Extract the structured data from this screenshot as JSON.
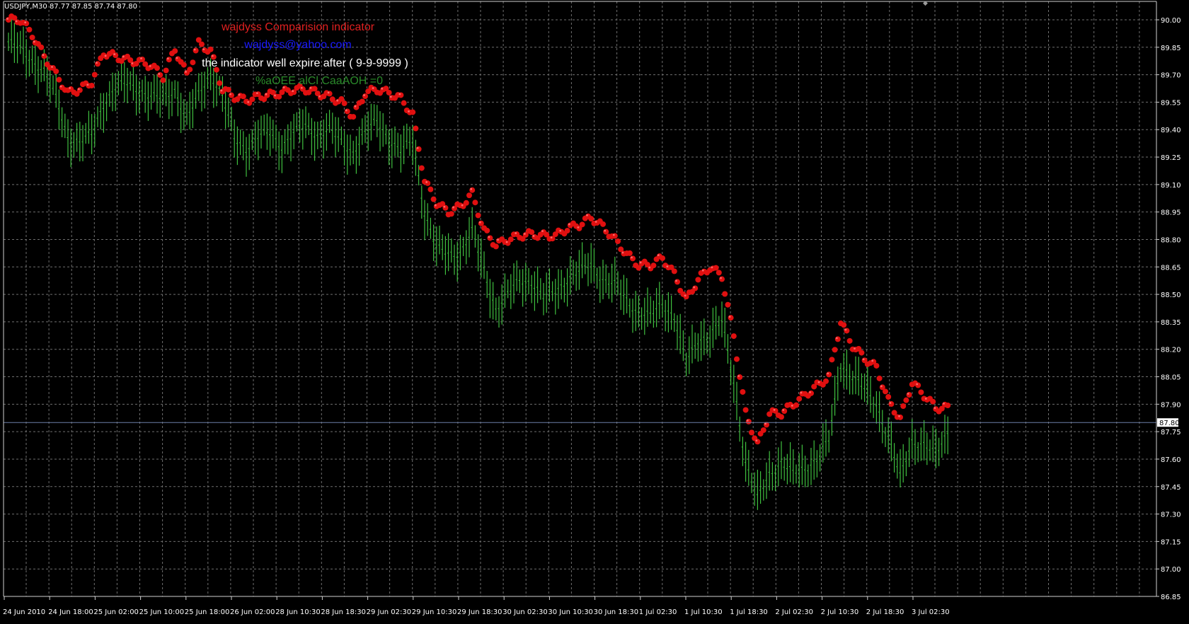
{
  "header": {
    "symbol_info": "USDJPY,M30  87.77 87.85 87.74 87.80",
    "scroll_marker": "◆"
  },
  "indicator": {
    "title": "wajdyss Comparision indicator",
    "email": "wajdyss@yahoo.com",
    "expiry": "the indicator well expire after ( 9-9-9999 )",
    "garbled_line": "%aOEE alCl CaaAOH =0"
  },
  "colors": {
    "background": "#000000",
    "grid": "#6f6f6f",
    "price_bars": "#3fbf3f",
    "indicator_markers": "#e01010",
    "title_text": "#e02020",
    "email_text": "#1a1aff",
    "expiry_text": "#ffffff",
    "garbled_text": "#2a8a2a",
    "current_price_line": "#6c7fa8"
  },
  "chart_data": {
    "type": "bar",
    "title": "",
    "xlabel": "",
    "ylabel": "",
    "ylim": [
      86.85,
      90.0
    ],
    "grid": true,
    "y_ticks": [
      "90.00",
      "89.85",
      "89.70",
      "89.55",
      "89.40",
      "89.25",
      "89.10",
      "88.95",
      "88.80",
      "88.65",
      "88.50",
      "88.35",
      "88.20",
      "88.05",
      "87.90",
      "87.75",
      "87.60",
      "87.45",
      "87.30",
      "87.15",
      "87.00",
      "86.85"
    ],
    "x_ticks": [
      "24 Jun 2010",
      "24 Jun 18:00",
      "25 Jun 02:00",
      "25 Jun 10:00",
      "25 Jun 18:00",
      "26 Jun 02:00",
      "28 Jun 10:30",
      "28 Jun 18:30",
      "29 Jun 02:30",
      "29 Jun 10:30",
      "29 Jun 18:30",
      "30 Jun 02:30",
      "30 Jun 10:30",
      "30 Jun 18:30",
      "1 Jul 02:30",
      "1 Jul 10:30",
      "1 Jul 18:30",
      "2 Jul 02:30",
      "2 Jul 10:30",
      "2 Jul 18:30",
      "3 Jul 02:30"
    ],
    "current_price": 87.8,
    "current_price_label": "87.80",
    "series": [
      {
        "kind": "price-bars",
        "points": [
          [
            0,
            89.88
          ],
          [
            4,
            89.84
          ],
          [
            8,
            89.78
          ],
          [
            12,
            89.72
          ],
          [
            16,
            89.57
          ],
          [
            20,
            89.36
          ],
          [
            24,
            89.33
          ],
          [
            28,
            89.37
          ],
          [
            32,
            89.54
          ],
          [
            36,
            89.63
          ],
          [
            40,
            89.65
          ],
          [
            44,
            89.62
          ],
          [
            48,
            89.58
          ],
          [
            52,
            89.57
          ],
          [
            56,
            89.62
          ],
          [
            60,
            89.45
          ],
          [
            64,
            89.59
          ],
          [
            68,
            89.71
          ],
          [
            72,
            89.58
          ],
          [
            76,
            89.35
          ],
          [
            80,
            89.3
          ],
          [
            84,
            89.36
          ],
          [
            88,
            89.38
          ],
          [
            92,
            89.31
          ],
          [
            96,
            89.38
          ],
          [
            100,
            89.42
          ],
          [
            104,
            89.37
          ],
          [
            108,
            89.4
          ],
          [
            112,
            89.33
          ],
          [
            116,
            89.28
          ],
          [
            120,
            89.38
          ],
          [
            124,
            89.45
          ],
          [
            128,
            89.35
          ],
          [
            132,
            89.28
          ],
          [
            136,
            89.34
          ],
          [
            140,
            88.95
          ],
          [
            144,
            88.75
          ],
          [
            148,
            88.72
          ],
          [
            152,
            88.73
          ],
          [
            156,
            88.84
          ],
          [
            160,
            88.63
          ],
          [
            164,
            88.42
          ],
          [
            168,
            88.5
          ],
          [
            172,
            88.58
          ],
          [
            176,
            88.57
          ],
          [
            180,
            88.48
          ],
          [
            184,
            88.52
          ],
          [
            188,
            88.58
          ],
          [
            192,
            88.62
          ],
          [
            196,
            88.67
          ],
          [
            200,
            88.58
          ],
          [
            204,
            88.55
          ],
          [
            208,
            88.47
          ],
          [
            212,
            88.4
          ],
          [
            216,
            88.38
          ],
          [
            220,
            88.45
          ],
          [
            224,
            88.38
          ],
          [
            228,
            88.12
          ],
          [
            232,
            88.25
          ],
          [
            236,
            88.28
          ],
          [
            240,
            88.35
          ],
          [
            244,
            88.02
          ],
          [
            248,
            87.58
          ],
          [
            252,
            87.38
          ],
          [
            256,
            87.52
          ],
          [
            260,
            87.58
          ],
          [
            264,
            87.52
          ],
          [
            268,
            87.55
          ],
          [
            272,
            87.6
          ],
          [
            276,
            87.7
          ],
          [
            280,
            88.12
          ],
          [
            284,
            88.05
          ],
          [
            288,
            87.98
          ],
          [
            292,
            87.9
          ],
          [
            296,
            87.72
          ],
          [
            300,
            87.5
          ],
          [
            304,
            87.7
          ],
          [
            308,
            87.68
          ],
          [
            312,
            87.62
          ],
          [
            316,
            87.75
          ]
        ]
      },
      {
        "kind": "indicator-markers",
        "points": [
          [
            0,
            90.0
          ],
          [
            4,
            90.0
          ],
          [
            8,
            89.92
          ],
          [
            12,
            89.8
          ],
          [
            16,
            89.7
          ],
          [
            20,
            89.6
          ],
          [
            24,
            89.62
          ],
          [
            28,
            89.66
          ],
          [
            32,
            89.82
          ],
          [
            36,
            89.8
          ],
          [
            40,
            89.78
          ],
          [
            44,
            89.77
          ],
          [
            48,
            89.75
          ],
          [
            52,
            89.69
          ],
          [
            56,
            89.84
          ],
          [
            60,
            89.7
          ],
          [
            64,
            89.87
          ],
          [
            68,
            89.83
          ],
          [
            72,
            89.62
          ],
          [
            76,
            89.58
          ],
          [
            80,
            89.56
          ],
          [
            84,
            89.58
          ],
          [
            88,
            89.59
          ],
          [
            92,
            89.6
          ],
          [
            96,
            89.62
          ],
          [
            100,
            89.62
          ],
          [
            104,
            89.6
          ],
          [
            108,
            89.58
          ],
          [
            112,
            89.55
          ],
          [
            116,
            89.47
          ],
          [
            120,
            89.6
          ],
          [
            124,
            89.62
          ],
          [
            128,
            89.6
          ],
          [
            132,
            89.57
          ],
          [
            136,
            89.48
          ],
          [
            140,
            89.12
          ],
          [
            144,
            89.0
          ],
          [
            148,
            88.95
          ],
          [
            152,
            88.98
          ],
          [
            156,
            89.05
          ],
          [
            160,
            88.85
          ],
          [
            164,
            88.77
          ],
          [
            168,
            88.8
          ],
          [
            172,
            88.82
          ],
          [
            176,
            88.83
          ],
          [
            180,
            88.82
          ],
          [
            184,
            88.82
          ],
          [
            188,
            88.86
          ],
          [
            192,
            88.88
          ],
          [
            196,
            88.92
          ],
          [
            200,
            88.87
          ],
          [
            204,
            88.8
          ],
          [
            208,
            88.72
          ],
          [
            212,
            88.66
          ],
          [
            216,
            88.66
          ],
          [
            220,
            88.7
          ],
          [
            224,
            88.61
          ],
          [
            228,
            88.47
          ],
          [
            232,
            88.58
          ],
          [
            236,
            88.65
          ],
          [
            240,
            88.6
          ],
          [
            244,
            88.27
          ],
          [
            248,
            87.85
          ],
          [
            252,
            87.68
          ],
          [
            256,
            87.85
          ],
          [
            260,
            87.85
          ],
          [
            264,
            87.9
          ],
          [
            268,
            87.95
          ],
          [
            272,
            88.0
          ],
          [
            276,
            88.05
          ],
          [
            280,
            88.35
          ],
          [
            284,
            88.22
          ],
          [
            288,
            88.15
          ],
          [
            292,
            88.1
          ],
          [
            296,
            87.92
          ],
          [
            300,
            87.82
          ],
          [
            304,
            88.02
          ],
          [
            308,
            87.95
          ],
          [
            312,
            87.88
          ],
          [
            316,
            87.88
          ]
        ]
      }
    ]
  }
}
